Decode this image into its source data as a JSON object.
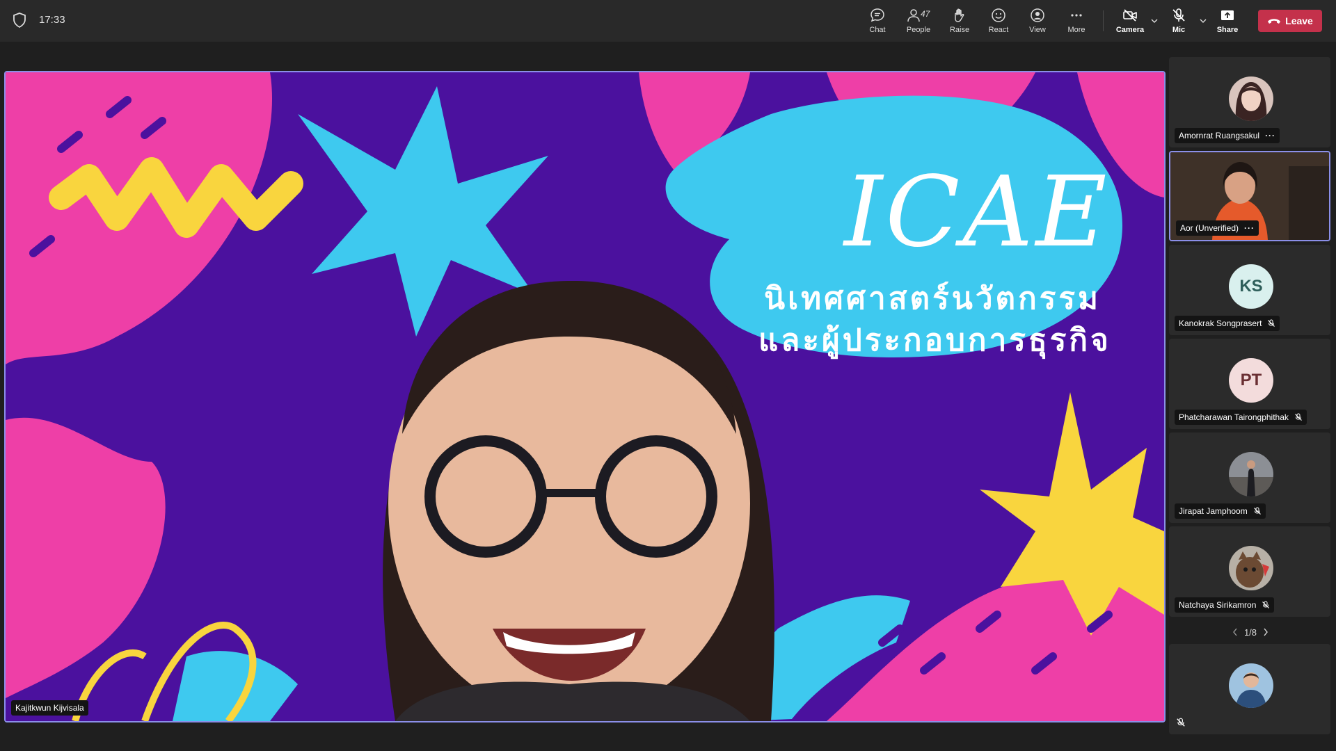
{
  "topbar": {
    "time": "17:33",
    "chat_label": "Chat",
    "people_label": "People",
    "people_count": "47",
    "raise_label": "Raise",
    "react_label": "React",
    "view_label": "View",
    "more_label": "More",
    "camera_label": "Camera",
    "mic_label": "Mic",
    "share_label": "Share",
    "leave_label": "Leave",
    "leave_color": "#c4314b"
  },
  "stage": {
    "speaker_name": "Kajitkwun Kijvisala",
    "slide_title": "ICAE",
    "slide_line1": "นิเทศศาสตร์นวัตกรรม",
    "slide_line2": "และผู้ประกอบการธุรกิจ",
    "accent_border": "#8b8fe8"
  },
  "roster": {
    "participants": [
      {
        "name": "Amornrat Ruangsakul",
        "avatar": "photo",
        "more": "···"
      },
      {
        "name": "Aor (Unverified)",
        "avatar": "video",
        "more": "···"
      },
      {
        "name": "Kanokrak Songprasert",
        "initials": "KS",
        "muted": true
      },
      {
        "name": "Phatcharawan Tairongphithak",
        "initials": "PT",
        "muted": true
      },
      {
        "name": "Jirapat Jamphoom",
        "avatar": "photo",
        "muted": true
      },
      {
        "name": "Natchaya Sirikamron",
        "avatar": "photo",
        "muted": true
      }
    ],
    "page": "1/8",
    "bottom_tile_muted": true
  }
}
